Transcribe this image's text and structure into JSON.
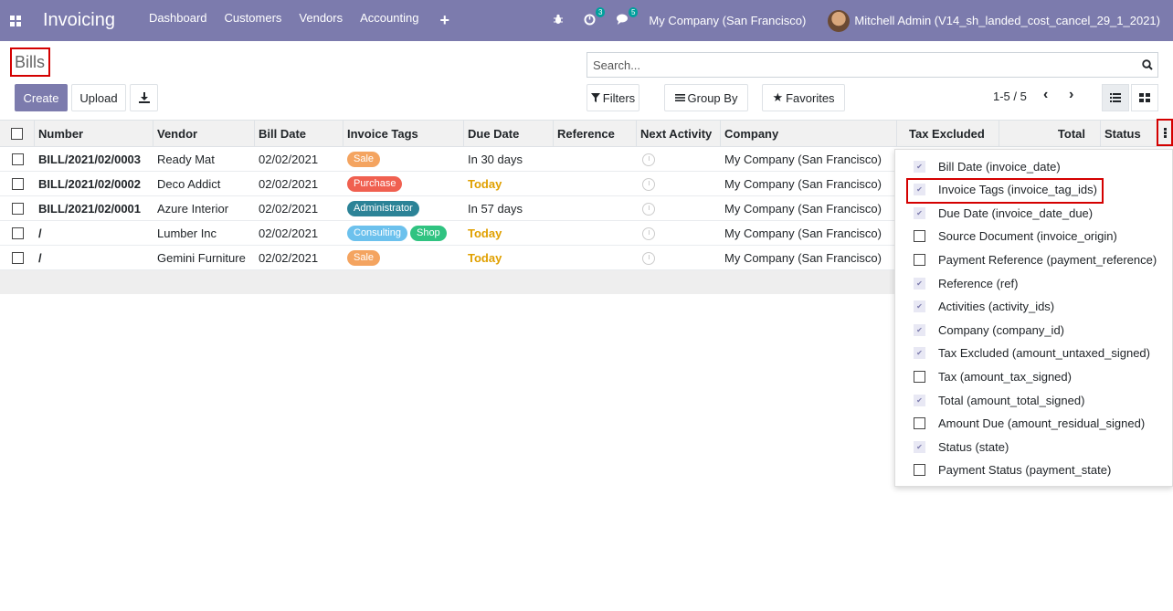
{
  "navbar": {
    "app_title": "Invoicing",
    "menu": [
      "Dashboard",
      "Customers",
      "Vendors",
      "Accounting"
    ],
    "activity_count": "3",
    "messages_count": "5",
    "company": "My Company (San Francisco)",
    "user": "Mitchell Admin (V14_sh_landed_cost_cancel_29_1_2021)"
  },
  "control_panel": {
    "title": "Bills",
    "create_label": "Create",
    "upload_label": "Upload",
    "search_placeholder": "Search...",
    "filters_label": "Filters",
    "groupby_label": "Group By",
    "favorites_label": "Favorites",
    "pager": "1-5 / 5"
  },
  "table": {
    "headers": [
      "Number",
      "Vendor",
      "Bill Date",
      "Invoice Tags",
      "Due Date",
      "Reference",
      "Next Activity",
      "Company",
      "Tax Excluded",
      "Total",
      "Status"
    ],
    "rows": [
      {
        "number": "BILL/2021/02/0003",
        "vendor": "Ready Mat",
        "bill_date": "02/02/2021",
        "tags": [
          {
            "label": "Sale",
            "color": "#f4a460"
          }
        ],
        "due": "In 30 days",
        "due_today": false,
        "company": "My Company (San Francisco)"
      },
      {
        "number": "BILL/2021/02/0002",
        "vendor": "Deco Addict",
        "bill_date": "02/02/2021",
        "tags": [
          {
            "label": "Purchase",
            "color": "#f06050"
          }
        ],
        "due": "Today",
        "due_today": true,
        "company": "My Company (San Francisco)"
      },
      {
        "number": "BILL/2021/02/0001",
        "vendor": "Azure Interior",
        "bill_date": "02/02/2021",
        "tags": [
          {
            "label": "Administrator",
            "color": "#2c8397"
          }
        ],
        "due": "In 57 days",
        "due_today": false,
        "company": "My Company (San Francisco)"
      },
      {
        "number": "/",
        "vendor": "Lumber Inc",
        "bill_date": "02/02/2021",
        "tags": [
          {
            "label": "Consulting",
            "color": "#6cc1ed"
          },
          {
            "label": "Shop",
            "color": "#30c381"
          }
        ],
        "due": "Today",
        "due_today": true,
        "company": "My Company (San Francisco)"
      },
      {
        "number": "/",
        "vendor": "Gemini Furniture",
        "bill_date": "02/02/2021",
        "tags": [
          {
            "label": "Sale",
            "color": "#f4a460"
          }
        ],
        "due": "Today",
        "due_today": true,
        "company": "My Company (San Francisco)"
      }
    ]
  },
  "columns_dropdown": {
    "options": [
      {
        "label": "Bill Date (invoice_date)",
        "checked": true
      },
      {
        "label": "Invoice Tags (invoice_tag_ids)",
        "checked": true
      },
      {
        "label": "Due Date (invoice_date_due)",
        "checked": true
      },
      {
        "label": "Source Document (invoice_origin)",
        "checked": false
      },
      {
        "label": "Payment Reference (payment_reference)",
        "checked": false
      },
      {
        "label": "Reference (ref)",
        "checked": true
      },
      {
        "label": "Activities (activity_ids)",
        "checked": true
      },
      {
        "label": "Company (company_id)",
        "checked": true
      },
      {
        "label": "Tax Excluded (amount_untaxed_signed)",
        "checked": true
      },
      {
        "label": "Tax (amount_tax_signed)",
        "checked": false
      },
      {
        "label": "Total (amount_total_signed)",
        "checked": true
      },
      {
        "label": "Amount Due (amount_residual_signed)",
        "checked": false
      },
      {
        "label": "Status (state)",
        "checked": true
      },
      {
        "label": "Payment Status (payment_state)",
        "checked": false
      }
    ]
  },
  "colors": {
    "brand": "#7c7bad",
    "highlight": "#d40000",
    "today": "#e0a000"
  }
}
